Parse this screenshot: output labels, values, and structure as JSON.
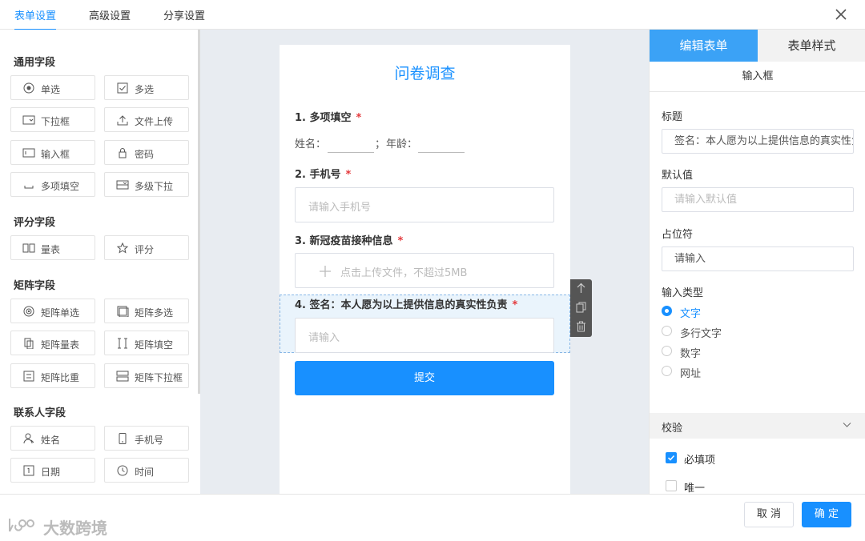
{
  "tabs": [
    {
      "label": "表单设置"
    },
    {
      "label": "高级设置"
    },
    {
      "label": "分享设置"
    }
  ],
  "left": {
    "groups": [
      {
        "title": "通用字段"
      },
      {
        "title": "评分字段"
      },
      {
        "title": "矩阵字段"
      },
      {
        "title": "联系人字段"
      }
    ],
    "fields": [
      {
        "label": "单选",
        "icon": "radio-icon"
      },
      {
        "label": "多选",
        "icon": "checkbox-icon"
      },
      {
        "label": "下拉框",
        "icon": "dropdown-icon"
      },
      {
        "label": "文件上传",
        "icon": "upload-icon"
      },
      {
        "label": "输入框",
        "icon": "input-icon"
      },
      {
        "label": "密码",
        "icon": "lock-icon"
      },
      {
        "label": "多项填空",
        "icon": "blank-icon"
      },
      {
        "label": "多级下拉",
        "icon": "cascade-icon"
      },
      {
        "label": "量表",
        "icon": "scale-icon"
      },
      {
        "label": "评分",
        "icon": "star-icon"
      },
      {
        "label": "矩阵单选",
        "icon": "matrix-radio-icon"
      },
      {
        "label": "矩阵多选",
        "icon": "matrix-checkbox-icon"
      },
      {
        "label": "矩阵量表",
        "icon": "matrix-scale-icon"
      },
      {
        "label": "矩阵填空",
        "icon": "matrix-fill-icon"
      },
      {
        "label": "矩阵比重",
        "icon": "matrix-weight-icon"
      },
      {
        "label": "矩阵下拉框",
        "icon": "matrix-dropdown-icon"
      },
      {
        "label": "姓名",
        "icon": "user-icon"
      },
      {
        "label": "手机号",
        "icon": "phone-icon"
      },
      {
        "label": "日期",
        "icon": "calendar-icon"
      },
      {
        "label": "时间",
        "icon": "clock-icon"
      }
    ]
  },
  "form": {
    "title": "问卷调查",
    "q1": {
      "label": "1. 多项填空",
      "req": "*",
      "name_label": "姓名：",
      "sep": "；",
      "age_label": "年龄："
    },
    "q2": {
      "label": "2. 手机号",
      "req": "*",
      "placeholder": "请输入手机号"
    },
    "q3": {
      "label": "3. 新冠疫苗接种信息",
      "req": "*",
      "upload_text": "点击上传文件，不超过5MB"
    },
    "q4": {
      "label": "4. 签名：本人愿为以上提供信息的真实性负责",
      "req": "*",
      "placeholder": "请输入"
    },
    "submit": "提交"
  },
  "right": {
    "tab_edit": "编辑表单",
    "tab_style": "表单样式",
    "subhead": "输入框",
    "title_label": "标题",
    "title_value": "签名：本人愿为以上提供信息的真实性负责",
    "default_label": "默认值",
    "default_placeholder": "请输入默认值",
    "placeholder_label": "占位符",
    "placeholder_value": "请输入",
    "type_label": "输入类型",
    "types": [
      {
        "label": "文字",
        "selected": true
      },
      {
        "label": "多行文字",
        "selected": false
      },
      {
        "label": "数字",
        "selected": false
      },
      {
        "label": "网址",
        "selected": false
      }
    ],
    "validation_label": "校验",
    "checks": [
      {
        "label": "必填项",
        "checked": true
      },
      {
        "label": "唯一",
        "checked": false
      }
    ]
  },
  "footer": {
    "cancel": "取 消",
    "ok": "确 定"
  },
  "watermark": "大数跨境",
  "colors": {
    "accent": "#1890ff",
    "required": "#e4393c"
  }
}
